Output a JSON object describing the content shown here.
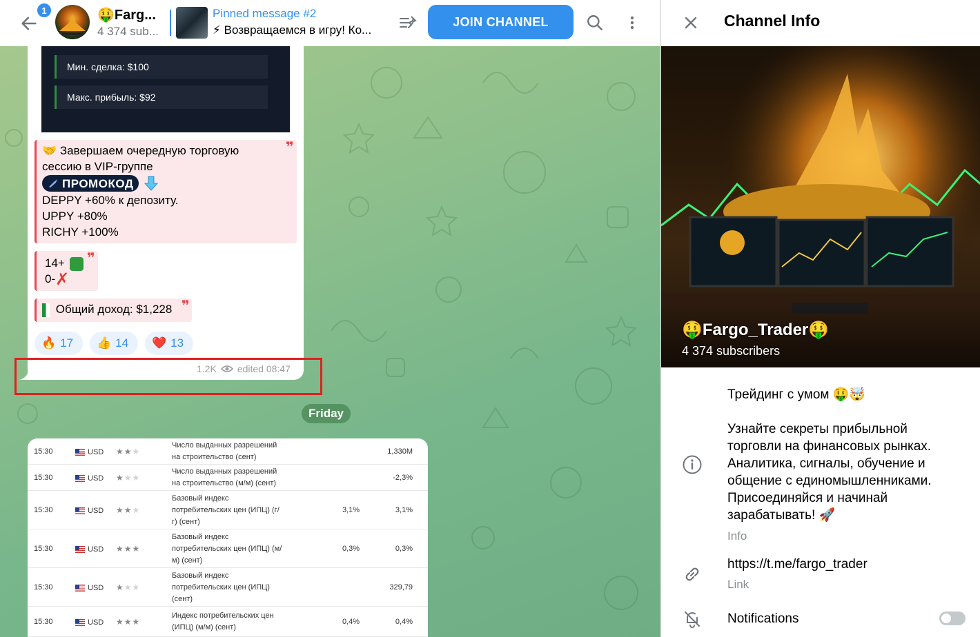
{
  "header": {
    "unread_count": "1",
    "channel_title": "🤑Farg...",
    "channel_subs": "4 374 sub...",
    "pinned_title": "Pinned message #2",
    "pinned_text": "⚡ Возвращаемся в игру! Ко...",
    "join_label": "JOIN CHANNEL"
  },
  "message": {
    "media_rows": [
      "Мин. сделка: $100",
      "Макс. прибыль: $92"
    ],
    "quote1_lines": [
      "🤝 Завершаем очередную торговую",
      "сессию в VIP-группе"
    ],
    "promo_label": "ПРОМОКОД",
    "promo_lines": [
      "DEPPY +60% к депозиту.",
      "UPPY +80%",
      "RICHY +100%"
    ],
    "quote2_line1": "14+",
    "quote2_line2": "0-",
    "quote3_text": "Общий доход: $1,228",
    "reactions": [
      {
        "emoji": "🔥",
        "count": "17"
      },
      {
        "emoji": "👍",
        "count": "14"
      },
      {
        "emoji": "❤️",
        "count": "13"
      }
    ],
    "views": "1.2K",
    "edited": "edited 08:47"
  },
  "date_separator": "Friday",
  "calendar_table": {
    "rows": [
      {
        "time": "15:30",
        "currency": "USD",
        "importance": 2,
        "event": [
          "Число выданных разрешений",
          "на строительство (сент)"
        ],
        "forecast": "",
        "previous": "1,330M"
      },
      {
        "time": "15:30",
        "currency": "USD",
        "importance": 1,
        "event": [
          "Число выданных разрешений",
          "на строительство (м/м) (сент)"
        ],
        "forecast": "",
        "previous": "-2,3%"
      },
      {
        "time": "15:30",
        "currency": "USD",
        "importance": 2,
        "event": [
          "Базовый индекс",
          "потребительских цен (ИПЦ) (г/",
          "г) (сент)"
        ],
        "forecast": "3,1%",
        "previous": "3,1%"
      },
      {
        "time": "15:30",
        "currency": "USD",
        "importance": 3,
        "event": [
          "Базовый индекс",
          "потребительских цен (ИПЦ) (м/",
          "м) (сент)"
        ],
        "forecast": "0,3%",
        "previous": "0,3%"
      },
      {
        "time": "15:30",
        "currency": "USD",
        "importance": 1,
        "event": [
          "Базовый индекс",
          "потребительских цен (ИПЦ)",
          "(сент)"
        ],
        "forecast": "",
        "previous": "329,79"
      },
      {
        "time": "15:30",
        "currency": "USD",
        "importance": 3,
        "event": [
          "Индекс потребительских цен",
          "(ИПЦ) (м/м) (сент)"
        ],
        "forecast": "0,4%",
        "previous": "0,4%"
      }
    ]
  },
  "info_panel": {
    "title": "Channel Info",
    "cover_name": "🤑Fargo_Trader🤑",
    "cover_subs": "4 374 subscribers",
    "tagline": "Трейдинг с умом 🤑🤯",
    "description": "Узнайте секреты прибыльной торговли на финансовых рынках. Аналитика, сигналы, обучение и общение с единомышленниками. Присоединяйся и начинай зарабатывать! 🚀",
    "info_label": "Info",
    "link": "https://t.me/fargo_trader",
    "link_label": "Link",
    "notifications_label": "Notifications"
  },
  "colors": {
    "accent": "#3390ec",
    "highlight": "#e02020",
    "quote": "#e5484d"
  }
}
